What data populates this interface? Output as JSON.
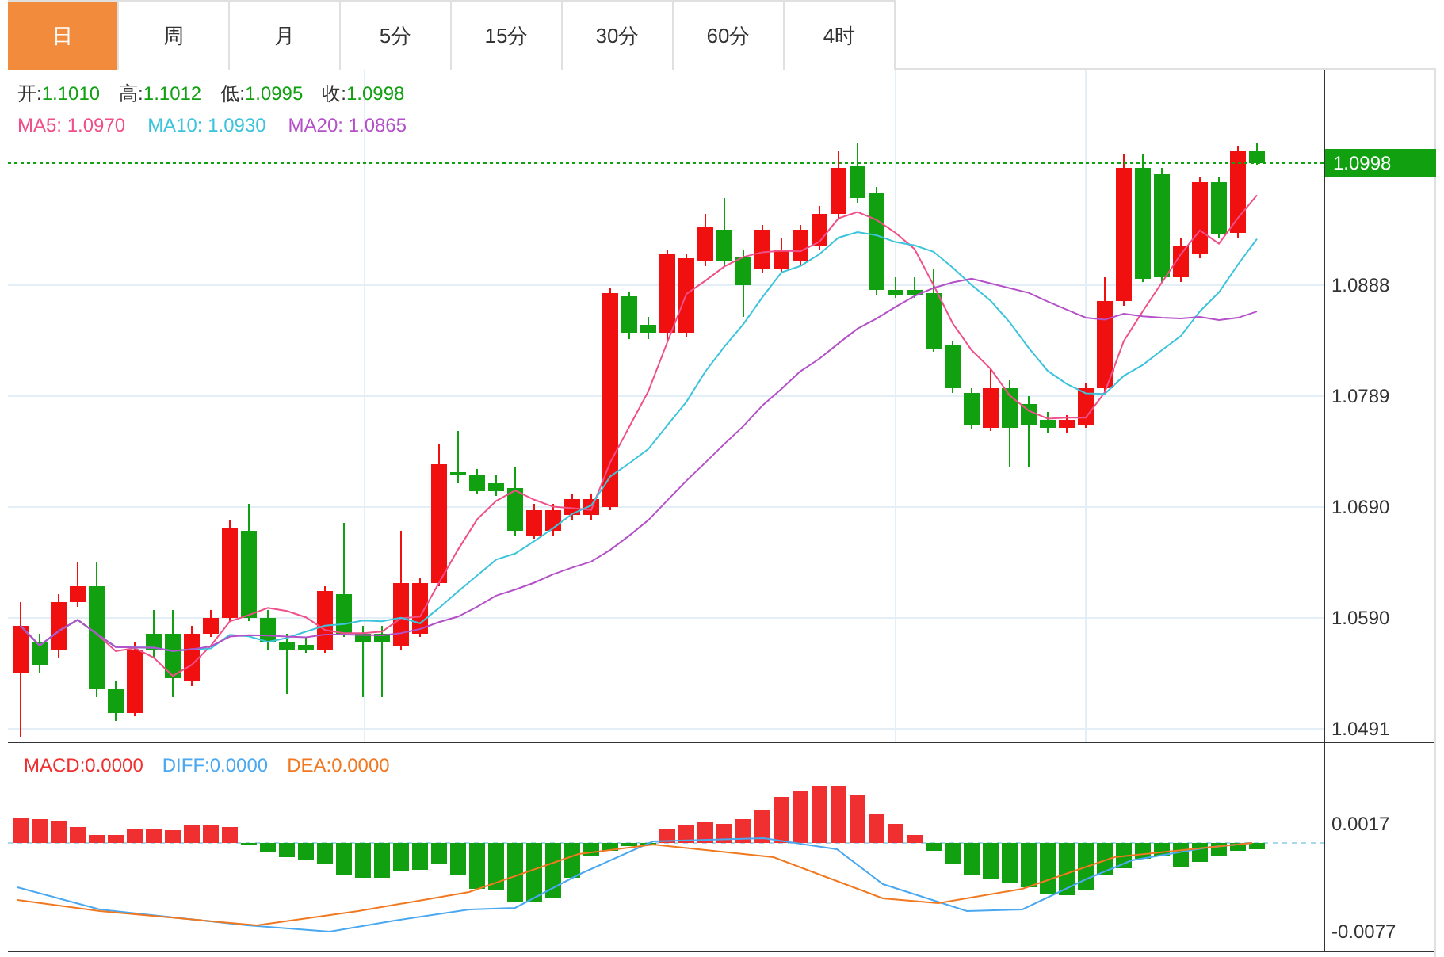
{
  "tabs": [
    {
      "label": "日",
      "selected": true
    },
    {
      "label": "周",
      "selected": false
    },
    {
      "label": "月",
      "selected": false
    },
    {
      "label": "5分",
      "selected": false
    },
    {
      "label": "15分",
      "selected": false
    },
    {
      "label": "30分",
      "selected": false
    },
    {
      "label": "60分",
      "selected": false
    },
    {
      "label": "4时",
      "selected": false
    }
  ],
  "ohlc": [
    {
      "label": "开:",
      "value": "1.1010"
    },
    {
      "label": "高:",
      "value": "1.1012"
    },
    {
      "label": "低:",
      "value": "1.0995"
    },
    {
      "label": "收:",
      "value": "1.0998"
    }
  ],
  "moving_averages": [
    {
      "label": "MA5:",
      "value": "1.0970",
      "color": "#f0508a"
    },
    {
      "label": "MA10:",
      "value": "1.0930",
      "color": "#3cc4dc"
    },
    {
      "label": "MA20:",
      "value": "1.0865",
      "color": "#b450c8"
    }
  ],
  "price_axis": [
    "1.0888",
    "1.0789",
    "1.0690",
    "1.0590",
    "1.0491"
  ],
  "current_price": "1.0998",
  "macd_legend": [
    {
      "label": "MACD:",
      "value": "0.0000",
      "color": "#f03030"
    },
    {
      "label": "DIFF:",
      "value": "0.0000",
      "color": "#4aa8f0"
    },
    {
      "label": "DEA:",
      "value": "0.0000",
      "color": "#f07820"
    }
  ],
  "macd_axis": [
    "0.0017",
    "-0.0077"
  ]
}
